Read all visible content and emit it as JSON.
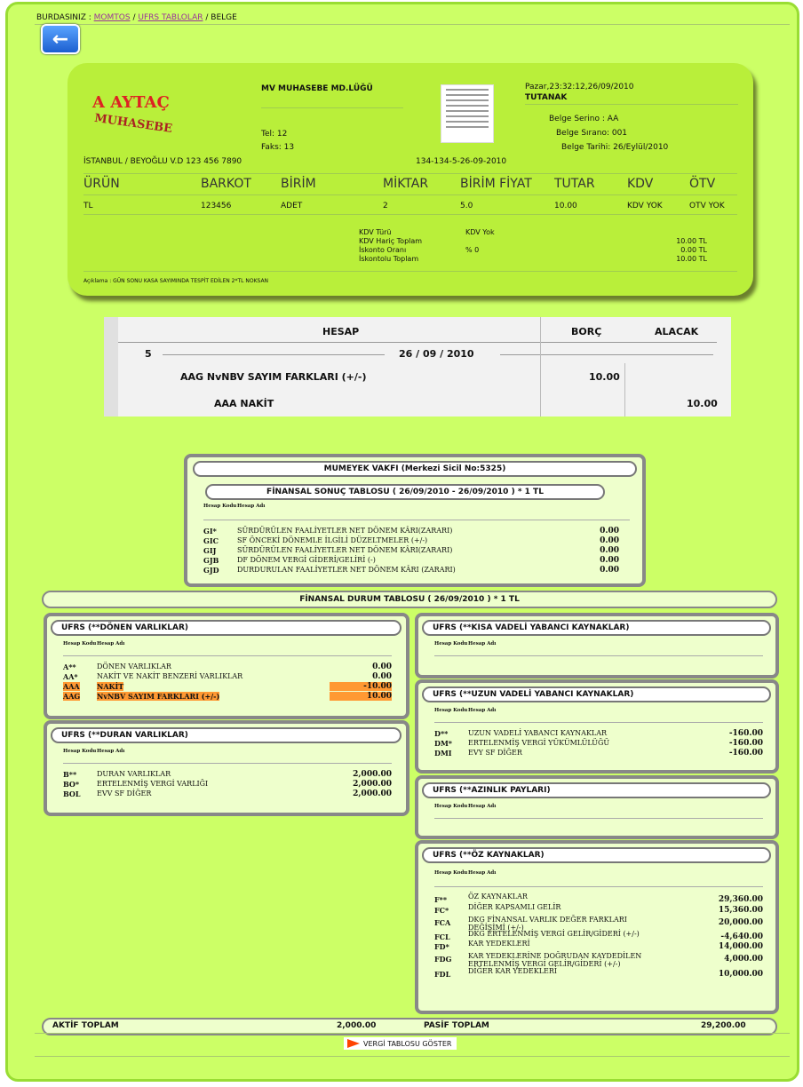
{
  "breadcrumb": {
    "prefix": "BURDASINIZ :",
    "items": [
      "MOMTOS",
      "UFRS TABLOLAR"
    ],
    "current": "BELGE",
    "sep": "/"
  },
  "receipt": {
    "logo_text_top": "A AYTAÇ",
    "logo_text_bottom": "MUHASEBE",
    "company": "MV MUHASEBE MD.LÜĞÜ",
    "tel": "Tel: 12",
    "faks": "Faks: 13",
    "address": "İSTANBUL / BEYOĞLU V.D 123 456 7890",
    "doc_code": "134-134-5-26-09-2010",
    "datetime": "Pazar,23:32:12,26/09/2010",
    "doc_type": "TUTANAK",
    "serial": "Belge Serino : AA",
    "order": "Belge Sırano: 001",
    "date": "Belge Tarihi: 26/Eylül/2010",
    "columns": [
      "ÜRÜN",
      "BARKOT",
      "BİRİM",
      "MİKTAR",
      "BİRİM FİYAT",
      "TUTAR",
      "KDV",
      "ÖTV"
    ],
    "row": [
      "TL",
      "123456",
      "ADET",
      "2",
      "5.0",
      "10.00",
      "KDV YOK",
      "OTV YOK"
    ],
    "summary_labels": [
      "KDV Türü",
      "KDV Hariç Toplam",
      "İskonto Oranı",
      "İskontolu Toplam"
    ],
    "summary_mid": [
      "KDV Yok",
      "",
      "% 0",
      ""
    ],
    "summary_values": [
      "",
      "10.00 TL",
      "0.00 TL",
      "10.00 TL"
    ],
    "note": "Açıklama : GÜN SONU KASA SAYIMINDA TESPİT EDİLEN 2*TL NOKSAN"
  },
  "ledger": {
    "headers": [
      "HESAP",
      "BORÇ",
      "ALACAK"
    ],
    "entry_no": "5",
    "entry_date": "26 / 09 / 2010",
    "lines": [
      {
        "account": "AAG NvNBV SAYIM FARKLARI (+/-)",
        "debit": "10.00",
        "credit": ""
      },
      {
        "account": "AAA NAKİT",
        "debit": "",
        "credit": "10.00"
      }
    ]
  },
  "result": {
    "org": "MUMEYEK VAKFI (Merkezi Sicil No:5325)",
    "title": "FİNANSAL SONUÇ TABLOSU ( 26/09/2010 - 26/09/2010 ) * 1 TL",
    "hdr_code": "Hesap Kodu",
    "hdr_name": "Hesap Adı",
    "rows": [
      {
        "code": "GI*",
        "name": "SÜRDÜRÜLEN FAALİYETLER NET DÖNEM KÂRI(ZARARI)",
        "amount": "0.00"
      },
      {
        "code": "GIC",
        "name": "SF ÖNCEKİ DÖNEMLE İLGİLİ DÜZELTMELER (+/-)",
        "amount": "0.00"
      },
      {
        "code": "GIJ",
        "name": "SÜRDÜRÜLEN FAALİYETLER NET DÖNEM KÂRI(ZARARI)",
        "amount": "0.00"
      },
      {
        "code": "GJB",
        "name": "DF DÖNEM VERGİ GİDERİ/GELİRİ (-)",
        "amount": "0.00"
      },
      {
        "code": "GJD",
        "name": "DURDURULAN FAALİYETLER NET DÖNEM KÂRI (ZARARI)",
        "amount": "0.00"
      }
    ]
  },
  "position": {
    "title": "FİNANSAL DURUM TABLOSU ( 26/09/2010 ) * 1 TL",
    "current_assets": {
      "title": "UFRS (**DÖNEN VARLIKLAR)",
      "rows": [
        {
          "code": "A**",
          "name": "DÖNEN VARLIKLAR",
          "amount": "0.00"
        },
        {
          "code": "AA*",
          "name": "NAKİT VE NAKİT BENZERİ VARLIKLAR",
          "amount": "0.00"
        },
        {
          "code": "AAA",
          "name": "NAKİT",
          "amount": "-10.00"
        },
        {
          "code": "AAG",
          "name": "NvNBV SAYIM FARKLARI (+/-)",
          "amount": "10.00"
        }
      ]
    },
    "fixed_assets": {
      "title": "UFRS (**DURAN VARLIKLAR)",
      "rows": [
        {
          "code": "B**",
          "name": "DURAN VARLIKLAR",
          "amount": "2,000.00"
        },
        {
          "code": "BO*",
          "name": "ERTELENMİŞ VERGİ VARLIĞI",
          "amount": "2,000.00"
        },
        {
          "code": "BOL",
          "name": "EVV SF DİĞER",
          "amount": "2,000.00"
        }
      ]
    },
    "short_liab": {
      "title": "UFRS (**KISA VADELİ YABANCI KAYNAKLAR)"
    },
    "long_liab": {
      "title": "UFRS (**UZUN VADELİ YABANCI KAYNAKLAR)",
      "rows": [
        {
          "code": "D**",
          "name": "UZUN VADELİ YABANCI KAYNAKLAR",
          "amount": "-160.00"
        },
        {
          "code": "DM*",
          "name": "ERTELENMİŞ VERGİ YÜKÜMLÜLÜĞÜ",
          "amount": "-160.00"
        },
        {
          "code": "DMI",
          "name": "EVY SF DİĞER",
          "amount": "-160.00"
        }
      ]
    },
    "minority": {
      "title": "UFRS (**AZINLIK PAYLARI)"
    },
    "equity": {
      "title": "UFRS (**ÖZ KAYNAKLAR)",
      "rows": [
        {
          "code": "F**",
          "name": "ÖZ KAYNAKLAR",
          "amount": "29,360.00"
        },
        {
          "code": "FC*",
          "name": "DİĞER KAPSAMLI GELİR",
          "amount": "15,360.00"
        },
        {
          "code": "FCA",
          "name": "DKG FİNANSAL VARLIK DEĞER FARKLARI DEĞİŞİMİ (+/-)",
          "amount": "20,000.00"
        },
        {
          "code": "FCL",
          "name": "DKG ERTELENMİŞ VERGİ GELİR/GİDERİ (+/-)",
          "amount": "-4,640.00"
        },
        {
          "code": "FD*",
          "name": "KAR YEDEKLERİ",
          "amount": "14,000.00"
        },
        {
          "code": "FDG",
          "name": "KAR YEDEKLERİNE DOĞRUDAN KAYDEDİLEN ERTELENMİŞ VERGİ GELİR/GİDERİ (+/-)",
          "amount": "4,000.00"
        },
        {
          "code": "FDL",
          "name": "DİĞER KAR YEDEKLERİ",
          "amount": "10,000.00"
        }
      ]
    },
    "active_total_label": "AKTİF TOPLAM",
    "active_total": "2,000.00",
    "passive_total_label": "PASİF TOPLAM",
    "passive_total": "29,200.00"
  },
  "tax_button": "VERGİ TABLOSU GÖSTER",
  "colors": {
    "page_bg": "#ccff66",
    "card_bg": "#b9ef3a",
    "highlight": "#ff9933"
  }
}
